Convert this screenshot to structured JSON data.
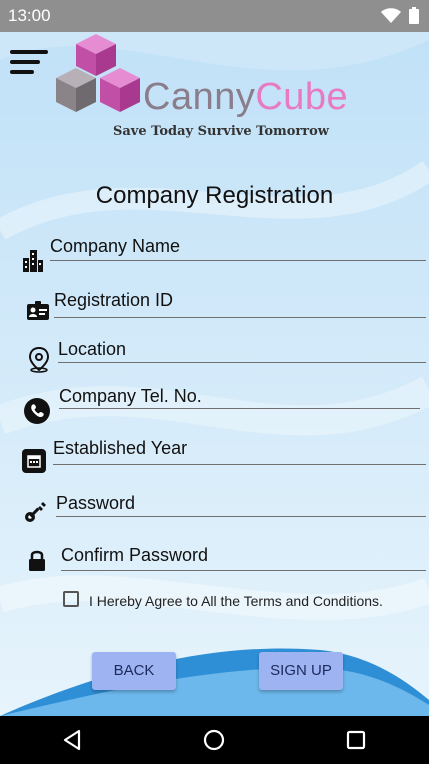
{
  "status_bar": {
    "time": "13:00",
    "icons": [
      "wifi-icon",
      "battery-icon"
    ]
  },
  "app": {
    "brand_part1": "Canny",
    "brand_part2": "Cube",
    "tagline": "Save Today Survive Tomorrow",
    "colors": {
      "brand_grey": "#8a7d8c",
      "brand_pink": "#e77ac0",
      "button": "#9db3f2"
    }
  },
  "form": {
    "title": "Company Registration",
    "fields": [
      {
        "label": "Company Name",
        "icon": "building-icon"
      },
      {
        "label": "Registration ID",
        "icon": "id-card-icon"
      },
      {
        "label": "Location",
        "icon": "location-pin-icon"
      },
      {
        "label": "Company Tel. No.",
        "icon": "phone-icon"
      },
      {
        "label": "Established Year",
        "icon": "calendar-icon"
      },
      {
        "label": "Password",
        "icon": "key-icon"
      },
      {
        "label": "Confirm Password",
        "icon": "lock-icon"
      }
    ],
    "terms": "I Hereby Agree to All the Terms and Conditions.",
    "terms_checked": false,
    "back_label": "BACK",
    "signup_label": "SIGN UP"
  },
  "nav_bar": {
    "icons": [
      "back-triangle-icon",
      "home-circle-icon",
      "recents-square-icon"
    ]
  }
}
